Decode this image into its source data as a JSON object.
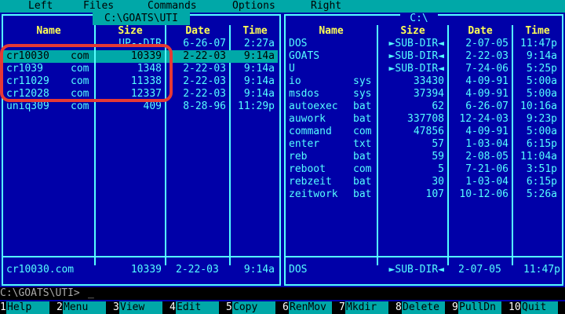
{
  "menu": {
    "items": [
      "Left",
      "Files",
      "Commands",
      "Options",
      "Right"
    ]
  },
  "left_panel": {
    "title": "C:\\GOATS\\UTI",
    "headers": {
      "name": "Name",
      "size": "Size",
      "date": "Date",
      "time": "Time"
    },
    "files": [
      {
        "name": "",
        "ext": "",
        "size": "UP--DIR",
        "date": "6-26-07",
        "time": "2:27a"
      },
      {
        "name": "cr10030",
        "ext": "com",
        "size": "10339",
        "date": "2-22-03",
        "time": "9:14a",
        "selected": true
      },
      {
        "name": "cr1039",
        "ext": "com",
        "size": "1348",
        "date": "2-22-03",
        "time": "9:14a"
      },
      {
        "name": "cr11029",
        "ext": "com",
        "size": "11338",
        "date": "2-22-03",
        "time": "9:14a"
      },
      {
        "name": "cr12028",
        "ext": "com",
        "size": "12337",
        "date": "2-22-03",
        "time": "9:14a"
      },
      {
        "name": "uniq309",
        "ext": "com",
        "size": "409",
        "date": "8-28-96",
        "time": "11:29p"
      }
    ],
    "status": {
      "name": "cr10030.com",
      "size": "10339",
      "date": "2-22-03",
      "time": "9:14a"
    }
  },
  "right_panel": {
    "title": "C:\\",
    "headers": {
      "name": "Name",
      "size": "Size",
      "date": "Date",
      "time": "Time"
    },
    "files": [
      {
        "name": "DOS",
        "ext": "",
        "size": "►SUB-DIR◄",
        "date": "2-07-05",
        "time": "11:47p"
      },
      {
        "name": "GOATS",
        "ext": "",
        "size": "►SUB-DIR◄",
        "date": "2-22-03",
        "time": "9:14a"
      },
      {
        "name": "U",
        "ext": "",
        "size": "►SUB-DIR◄",
        "date": "7-24-06",
        "time": "5:25p"
      },
      {
        "name": "io",
        "ext": "sys",
        "size": "33430",
        "date": "4-09-91",
        "time": "5:00a"
      },
      {
        "name": "msdos",
        "ext": "sys",
        "size": "37394",
        "date": "4-09-91",
        "time": "5:00a"
      },
      {
        "name": "autoexec",
        "ext": "bat",
        "size": "62",
        "date": "6-26-07",
        "time": "10:16a"
      },
      {
        "name": "auwork",
        "ext": "bat",
        "size": "337708",
        "date": "12-24-03",
        "time": "9:23p"
      },
      {
        "name": "command",
        "ext": "com",
        "size": "47856",
        "date": "4-09-91",
        "time": "5:00a"
      },
      {
        "name": "enter",
        "ext": "txt",
        "size": "57",
        "date": "1-03-04",
        "time": "6:15p"
      },
      {
        "name": "reb",
        "ext": "bat",
        "size": "59",
        "date": "2-08-05",
        "time": "11:04a"
      },
      {
        "name": "reboot",
        "ext": "com",
        "size": "5",
        "date": "7-21-06",
        "time": "3:51p"
      },
      {
        "name": "rebzeit",
        "ext": "bat",
        "size": "30",
        "date": "1-03-04",
        "time": "6:15p"
      },
      {
        "name": "zeitwork",
        "ext": "bat",
        "size": "107",
        "date": "10-12-06",
        "time": "5:26a"
      }
    ],
    "status": {
      "name": "DOS",
      "size": "►SUB-DIR◄",
      "date": "2-07-05",
      "time": "11:47p"
    }
  },
  "command_line": {
    "prompt": "C:\\GOATS\\UTI>",
    "cursor": "_"
  },
  "keys": [
    {
      "num": "1",
      "label": "Help"
    },
    {
      "num": "2",
      "label": "Menu"
    },
    {
      "num": "3",
      "label": "View"
    },
    {
      "num": "4",
      "label": "Edit"
    },
    {
      "num": "5",
      "label": "Copy"
    },
    {
      "num": "6",
      "label": "RenMov"
    },
    {
      "num": "7",
      "label": "Mkdir"
    },
    {
      "num": "8",
      "label": "Delete"
    },
    {
      "num": "9",
      "label": "PullDn"
    },
    {
      "num": "10",
      "label": "Quit"
    }
  ],
  "colors": {
    "background": "#0000a8",
    "frame": "#55ffff",
    "header": "#ffff55",
    "selection": "#00a8a8",
    "annotation": "#e53935"
  }
}
